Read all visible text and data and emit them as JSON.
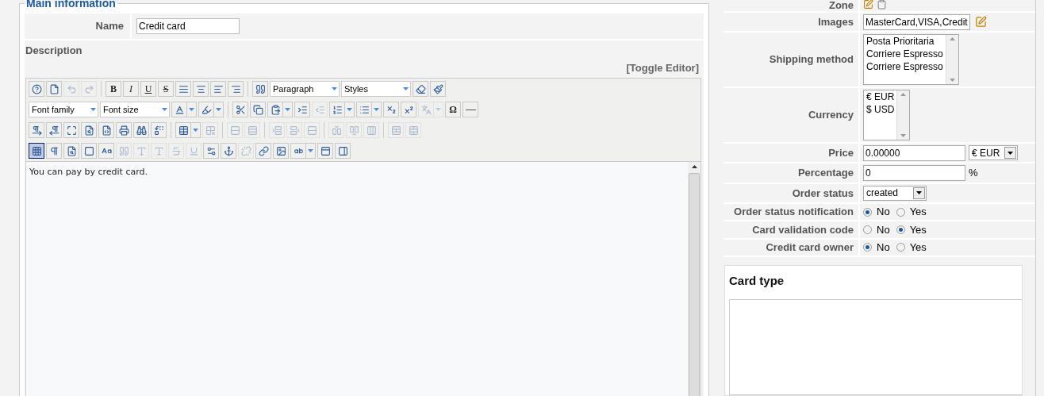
{
  "main_information": {
    "legend": "Main information",
    "name": {
      "label": "Name",
      "value": "Credit card"
    },
    "description": {
      "label": "Description",
      "toggle_link": "[Toggle Editor]",
      "toolbar_rows": [
        [
          {
            "kind": "icon",
            "disabled": false,
            "selected": false
          },
          {
            "kind": "icon",
            "disabled": false,
            "selected": false
          },
          {
            "kind": "icon",
            "disabled": true,
            "selected": false
          },
          {
            "kind": "icon",
            "disabled": true,
            "selected": false
          },
          {
            "kind": "separator"
          },
          {
            "kind": "text",
            "label": "B",
            "disabled": false,
            "selected": false
          },
          {
            "kind": "text",
            "label": "I",
            "disabled": false,
            "selected": false
          },
          {
            "kind": "text",
            "label": "U",
            "disabled": false,
            "selected": false
          },
          {
            "kind": "text",
            "label": "S",
            "disabled": false,
            "selected": false
          },
          {
            "kind": "icon",
            "disabled": false,
            "selected": false
          },
          {
            "kind": "icon",
            "disabled": false,
            "selected": false
          },
          {
            "kind": "icon",
            "disabled": false,
            "selected": false
          },
          {
            "kind": "icon",
            "disabled": false,
            "selected": false
          },
          {
            "kind": "separator"
          },
          {
            "kind": "icon",
            "disabled": false,
            "selected": false
          },
          {
            "kind": "select",
            "value": "Paragraph"
          },
          {
            "kind": "select",
            "value": "Styles"
          },
          {
            "kind": "icon",
            "disabled": false,
            "selected": false
          },
          {
            "kind": "icon",
            "disabled": false,
            "selected": false
          }
        ],
        [
          {
            "kind": "select",
            "value": "Font family"
          },
          {
            "kind": "select",
            "value": "Font size"
          },
          {
            "kind": "icon",
            "disabled": false,
            "selected": false,
            "dropdown": true
          },
          {
            "kind": "icon",
            "disabled": false,
            "selected": false,
            "dropdown": true
          },
          {
            "kind": "separator"
          },
          {
            "kind": "icon",
            "disabled": false,
            "selected": false
          },
          {
            "kind": "icon",
            "disabled": false,
            "selected": false
          },
          {
            "kind": "icon",
            "disabled": false,
            "selected": false,
            "dropdown": true
          },
          {
            "kind": "icon",
            "disabled": false,
            "selected": false
          },
          {
            "kind": "icon",
            "disabled": true,
            "selected": false
          },
          {
            "kind": "icon",
            "disabled": false,
            "selected": false,
            "dropdown": true
          },
          {
            "kind": "icon",
            "disabled": false,
            "selected": false,
            "dropdown": true
          },
          {
            "kind": "icon",
            "disabled": false,
            "selected": false
          },
          {
            "kind": "icon",
            "disabled": false,
            "selected": false
          },
          {
            "kind": "icon",
            "disabled": true,
            "selected": false,
            "dropdown": true
          },
          {
            "kind": "text",
            "label": "Ω",
            "disabled": false,
            "selected": false
          },
          {
            "kind": "icon",
            "disabled": false,
            "selected": false
          }
        ],
        [
          {
            "kind": "icon",
            "disabled": false,
            "selected": false
          },
          {
            "kind": "icon",
            "disabled": false,
            "selected": false
          },
          {
            "kind": "icon",
            "disabled": false,
            "selected": false
          },
          {
            "kind": "icon",
            "disabled": false,
            "selected": false
          },
          {
            "kind": "icon",
            "disabled": false,
            "selected": false
          },
          {
            "kind": "icon",
            "disabled": false,
            "selected": false
          },
          {
            "kind": "icon",
            "disabled": false,
            "selected": false
          },
          {
            "kind": "icon",
            "disabled": false,
            "selected": false
          },
          {
            "kind": "separator"
          },
          {
            "kind": "icon",
            "disabled": false,
            "selected": false,
            "dropdown": true
          },
          {
            "kind": "icon",
            "disabled": true,
            "selected": false
          },
          {
            "kind": "separator"
          },
          {
            "kind": "icon",
            "disabled": true,
            "selected": false
          },
          {
            "kind": "icon",
            "disabled": true,
            "selected": false
          },
          {
            "kind": "separator"
          },
          {
            "kind": "icon",
            "disabled": true,
            "selected": false
          },
          {
            "kind": "icon",
            "disabled": true,
            "selected": false
          },
          {
            "kind": "icon",
            "disabled": true,
            "selected": false
          },
          {
            "kind": "separator"
          },
          {
            "kind": "icon",
            "disabled": true,
            "selected": false
          },
          {
            "kind": "icon",
            "disabled": true,
            "selected": false
          },
          {
            "kind": "icon",
            "disabled": true,
            "selected": false
          },
          {
            "kind": "separator"
          },
          {
            "kind": "icon",
            "disabled": true,
            "selected": false
          },
          {
            "kind": "icon",
            "disabled": true,
            "selected": false
          }
        ],
        [
          {
            "kind": "icon",
            "disabled": false,
            "selected": true
          },
          {
            "kind": "icon",
            "disabled": false,
            "selected": false
          },
          {
            "kind": "icon",
            "disabled": false,
            "selected": false
          },
          {
            "kind": "icon",
            "disabled": false,
            "selected": false
          },
          {
            "kind": "icon",
            "disabled": false,
            "selected": false
          },
          {
            "kind": "icon",
            "disabled": true,
            "selected": false
          },
          {
            "kind": "icon",
            "disabled": true,
            "selected": false
          },
          {
            "kind": "icon",
            "disabled": true,
            "selected": false
          },
          {
            "kind": "icon",
            "disabled": true,
            "selected": false
          },
          {
            "kind": "icon",
            "disabled": true,
            "selected": false
          },
          {
            "kind": "icon",
            "disabled": false,
            "selected": false
          },
          {
            "kind": "icon",
            "disabled": false,
            "selected": false
          },
          {
            "kind": "icon",
            "disabled": true,
            "selected": false
          },
          {
            "kind": "icon",
            "disabled": false,
            "selected": false
          },
          {
            "kind": "icon",
            "disabled": false,
            "selected": false
          },
          {
            "kind": "icon",
            "disabled": false,
            "selected": false,
            "dropdown": true
          },
          {
            "kind": "icon",
            "disabled": false,
            "selected": false
          },
          {
            "kind": "icon",
            "disabled": false,
            "selected": false
          }
        ]
      ],
      "content": "You can pay by credit card."
    }
  },
  "details": [
    {
      "kind": "icons",
      "label": "Zone"
    },
    {
      "kind": "input_icon",
      "label": "Images",
      "value": "MasterCard,VISA,Credit"
    },
    {
      "kind": "listbox",
      "label": "Shipping method",
      "items": [
        "Posta Prioritaria",
        "Corriere Espresso",
        "Corriere Espresso"
      ]
    },
    {
      "kind": "listbox",
      "label": "Currency",
      "items": [
        "€ EUR",
        "$ USD"
      ]
    },
    {
      "kind": "input_select",
      "label": "Price",
      "value": "0.00000",
      "select": "€ EUR"
    },
    {
      "kind": "input_suffix",
      "label": "Percentage",
      "value": "0",
      "suffix": "%"
    },
    {
      "kind": "select",
      "label": "Order status",
      "value": "created"
    },
    {
      "kind": "radio",
      "label": "Order status notification",
      "options": [
        {
          "label": "No",
          "selected": true
        },
        {
          "label": "Yes",
          "selected": false
        }
      ]
    },
    {
      "kind": "radio",
      "label": "Card validation code",
      "options": [
        {
          "label": "No",
          "selected": false
        },
        {
          "label": "Yes",
          "selected": true
        }
      ]
    },
    {
      "kind": "radio",
      "label": "Credit card owner",
      "options": [
        {
          "label": "No",
          "selected": true
        },
        {
          "label": "Yes",
          "selected": false
        }
      ]
    }
  ],
  "card_type": {
    "title": "Card type"
  }
}
